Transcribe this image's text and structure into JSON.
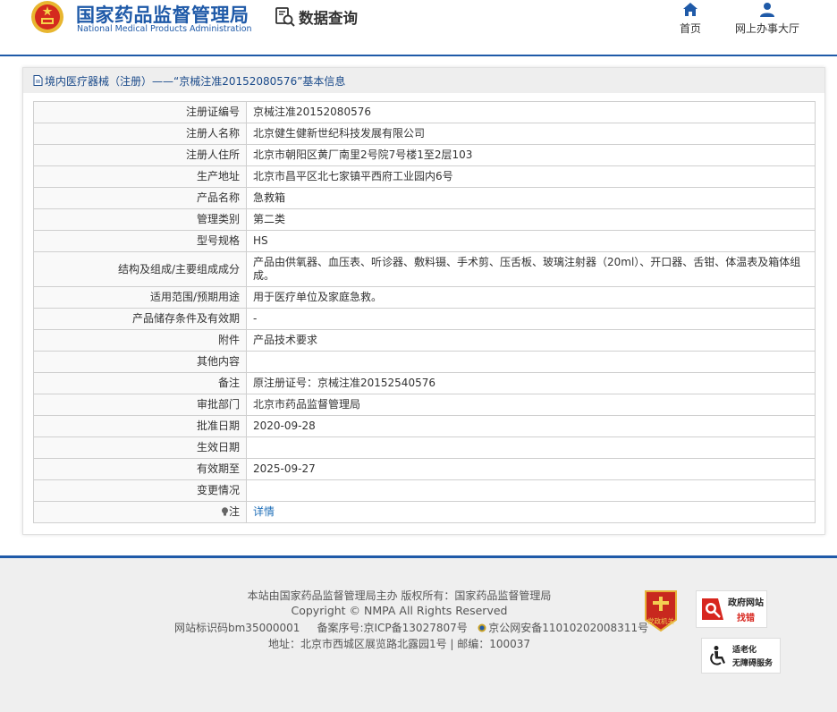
{
  "header": {
    "site_name_cn": "国家药品监督管理局",
    "site_name_en": "National Medical Products Administration",
    "data_query_label": "数据查询",
    "nav": [
      {
        "label": "首页",
        "icon": "home-icon"
      },
      {
        "label": "网上办事大厅",
        "icon": "user-icon"
      }
    ],
    "accent_color": "#1f5aa8"
  },
  "panel": {
    "title": "境内医疗器械（注册）——“京械注准20152080576”基本信息",
    "rows": [
      {
        "label": "注册证编号",
        "value": "京械注准20152080576"
      },
      {
        "label": "注册人名称",
        "value": "北京健生健新世纪科技发展有限公司"
      },
      {
        "label": "注册人住所",
        "value": "北京市朝阳区黄厂南里2号院7号楼1至2层103"
      },
      {
        "label": "生产地址",
        "value": "北京市昌平区北七家镇平西府工业园内6号"
      },
      {
        "label": "产品名称",
        "value": "急救箱"
      },
      {
        "label": "管理类别",
        "value": "第二类"
      },
      {
        "label": "型号规格",
        "value": "HS"
      },
      {
        "label": "结构及组成/主要组成成分",
        "value": "产品由供氧器、血压表、听诊器、敷料镊、手术剪、压舌板、玻璃注射器（20ml）、开口器、舌钳、体温表及箱体组成。"
      },
      {
        "label": "适用范围/预期用途",
        "value": "用于医疗单位及家庭急救。"
      },
      {
        "label": "产品储存条件及有效期",
        "value": "-"
      },
      {
        "label": "附件",
        "value": "产品技术要求"
      },
      {
        "label": "其他内容",
        "value": ""
      },
      {
        "label": "备注",
        "value": "原注册证号：京械注准20152540576"
      },
      {
        "label": "审批部门",
        "value": "北京市药品监督管理局"
      },
      {
        "label": "批准日期",
        "value": "2020-09-28"
      },
      {
        "label": "生效日期",
        "value": ""
      },
      {
        "label": "有效期至",
        "value": "2025-09-27"
      },
      {
        "label": "变更情况",
        "value": ""
      }
    ],
    "note_label": "注",
    "note_link": "详情"
  },
  "footer": {
    "line1": "本站由国家药品监督管理局主办 版权所有：国家药品监督管理局",
    "line2": "Copyright © NMPA All Rights Reserved",
    "site_id": "网站标识码bm35000001",
    "icp": "备案序号:京ICP备13027807号",
    "police": "京公网安备11010202008311号",
    "line4": "地址：北京市西城区展览路北露园1号 | 邮编：100037",
    "badge_org": "党政机关",
    "badge_find_1": "政府网站",
    "badge_find_2": "找错",
    "badge_access_1": "适老化",
    "badge_access_2": "无障碍服务"
  }
}
